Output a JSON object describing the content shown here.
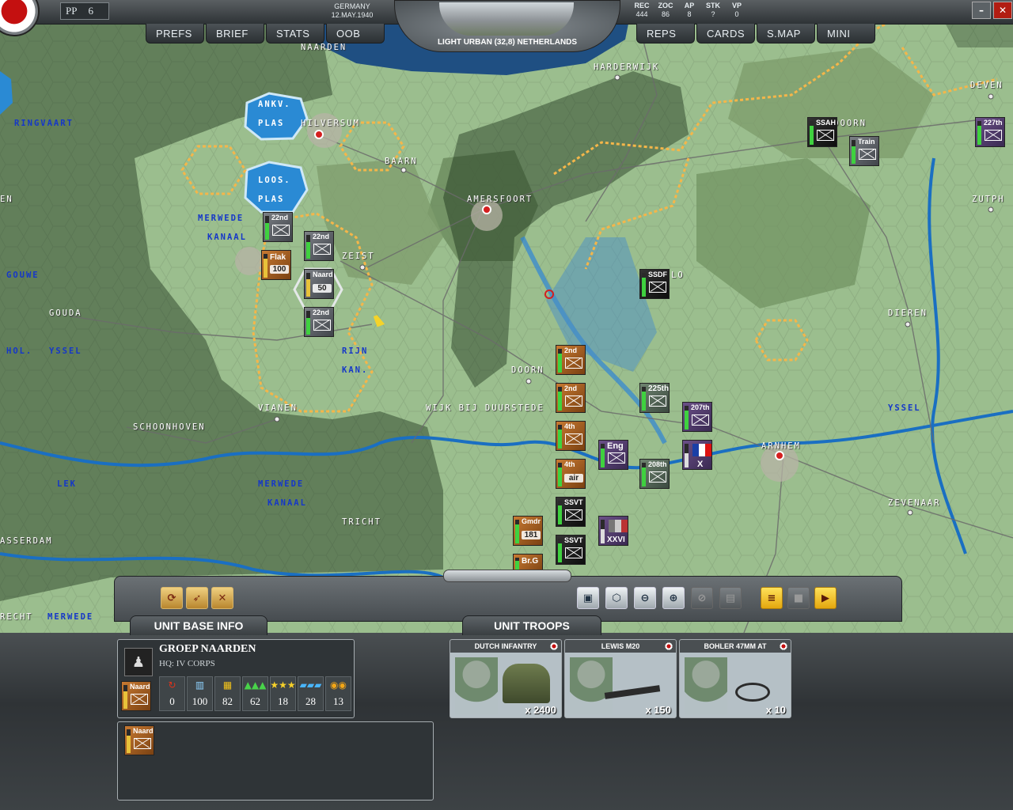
{
  "topbar": {
    "pp_label": "PP",
    "pp_value": "6",
    "nation": "GERMANY",
    "date": "12.MAY.1940",
    "terrain_info": "LIGHT URBAN (32,8) NETHERLANDS",
    "stats": [
      {
        "label": "REC",
        "value": "444"
      },
      {
        "label": "ZOC",
        "value": "86"
      },
      {
        "label": "AP",
        "value": "8"
      },
      {
        "label": "STK",
        "value": "?"
      },
      {
        "label": "VP",
        "value": "0"
      }
    ],
    "left_menu": [
      "PREFS",
      "BRIEF",
      "STATS",
      "OOB"
    ],
    "right_menu": [
      "REPS",
      "CARDS",
      "S.MAP",
      "MINI"
    ],
    "window_minimize": "–",
    "window_close": "✕"
  },
  "map": {
    "places": [
      {
        "id": "naarden",
        "name": "NAARDEN"
      },
      {
        "id": "harderwijk",
        "name": "HARDERWIJK"
      },
      {
        "id": "deventer",
        "name": "DEVEN"
      },
      {
        "id": "hilversum",
        "name": "HILVERSUM"
      },
      {
        "id": "apeldoorn",
        "name": "APELDOORN"
      },
      {
        "id": "baarn",
        "name": "BAARN"
      },
      {
        "id": "amersfoort",
        "name": "AMERSFOORT"
      },
      {
        "id": "zutphen",
        "name": "ZUTPH"
      },
      {
        "id": "zeist",
        "name": "ZEIST"
      },
      {
        "id": "barneveld",
        "name": "LO"
      },
      {
        "id": "gouda",
        "name": "GOUDA"
      },
      {
        "id": "dieren",
        "name": "DIEREN"
      },
      {
        "id": "doorn",
        "name": "DOORN"
      },
      {
        "id": "wijk",
        "name": "WIJK BIJ DUURSTEDE"
      },
      {
        "id": "vianen",
        "name": "VIANEN"
      },
      {
        "id": "schoonhoven",
        "name": "SCHOONHOVEN"
      },
      {
        "id": "arnhem",
        "name": "ARNHEM"
      },
      {
        "id": "zevenaar",
        "name": "ZEVENAAR"
      },
      {
        "id": "tricht",
        "name": "TRICHT"
      },
      {
        "id": "asserdam",
        "name": "ASSERDAM"
      },
      {
        "id": "recht",
        "name": "RECHT"
      },
      {
        "id": "left_edge",
        "name": "EN"
      }
    ],
    "waters": [
      {
        "id": "ringvaart",
        "name": "RINGVAART"
      },
      {
        "id": "ankv",
        "name": "ANKV."
      },
      {
        "id": "plas1",
        "name": "PLAS"
      },
      {
        "id": "loos",
        "name": "LOOS."
      },
      {
        "id": "plas2",
        "name": "PLAS"
      },
      {
        "id": "merwede1",
        "name": "MERWEDE"
      },
      {
        "id": "kanaal1",
        "name": "KANAAL"
      },
      {
        "id": "gouwe",
        "name": "GOUWE"
      },
      {
        "id": "hol",
        "name": "HOL."
      },
      {
        "id": "yssel1",
        "name": "YSSEL"
      },
      {
        "id": "rijn",
        "name": "RIJN"
      },
      {
        "id": "kan",
        "name": "KAN."
      },
      {
        "id": "yssel2",
        "name": "YSSEL"
      },
      {
        "id": "lek",
        "name": "LEK"
      },
      {
        "id": "merwede2",
        "name": "MERWEDE"
      },
      {
        "id": "kanaal2",
        "name": "KANAAL"
      },
      {
        "id": "merwede3",
        "name": "MERWEDE"
      }
    ],
    "units": [
      {
        "id": "u1",
        "label": "22nd",
        "color": "gray"
      },
      {
        "id": "u2",
        "label": "22nd",
        "color": "gray"
      },
      {
        "id": "u3",
        "label": "Flak",
        "num": "100",
        "color": "brown"
      },
      {
        "id": "u4",
        "label": "Naard",
        "num": "50",
        "color": "gray"
      },
      {
        "id": "u5",
        "label": "22nd",
        "color": "gray"
      },
      {
        "id": "u6",
        "label": "SSAH",
        "color": "black"
      },
      {
        "id": "u7",
        "label": "Train",
        "color": "gray"
      },
      {
        "id": "u8",
        "label": "227th",
        "color": "purple"
      },
      {
        "id": "u9",
        "label": "SSDF",
        "color": "black"
      },
      {
        "id": "u10",
        "label": "2nd",
        "color": "brown"
      },
      {
        "id": "u11",
        "label": "2nd",
        "color": "brown"
      },
      {
        "id": "u12",
        "label": "4th",
        "color": "brown"
      },
      {
        "id": "u13",
        "label": "4th",
        "num": "air",
        "color": "brown"
      },
      {
        "id": "u14",
        "label": "Eng",
        "color": "purple"
      },
      {
        "id": "u15",
        "label": "225th",
        "color": "dgreen"
      },
      {
        "id": "u16",
        "label": "207th",
        "color": "purple"
      },
      {
        "id": "u17",
        "label": "208th",
        "color": "dgreen"
      },
      {
        "id": "u18",
        "label": "X",
        "color": "purple"
      },
      {
        "id": "u19",
        "label": "SSVT",
        "color": "black"
      },
      {
        "id": "u20",
        "label": "Gmdr",
        "num": "181",
        "color": "brown"
      },
      {
        "id": "u21",
        "label": "XXVI",
        "color": "purple"
      },
      {
        "id": "u22",
        "label": "SSVT",
        "color": "black"
      },
      {
        "id": "u23",
        "label": "Br.G",
        "color": "brown"
      }
    ]
  },
  "toolbar": {
    "tabs": [
      "UNIT BASE INFO",
      "UNIT TROOPS"
    ],
    "left_buttons": [
      "cycle-units-icon",
      "artillery-icon",
      "engineer-icon"
    ],
    "right_buttons": [
      "unit-view-icon",
      "hex-info-icon",
      "zoom-out-icon",
      "zoom-in-icon",
      "zoom-disabled-icon",
      "trash-icon",
      "report-icon",
      "save-icon",
      "end-turn-icon"
    ]
  },
  "unit_info": {
    "name": "GROEP NAARDEN",
    "hq": "HQ: IV CORPS",
    "counter_label": "Naard",
    "values": [
      {
        "icon": "supply-icon",
        "value": "0"
      },
      {
        "icon": "strength-icon",
        "value": "100"
      },
      {
        "icon": "ammo-icon",
        "value": "82"
      },
      {
        "icon": "morale-icon",
        "value": "62"
      },
      {
        "icon": "experience-icon",
        "value": "18"
      },
      {
        "icon": "entrench-icon",
        "value": "28"
      },
      {
        "icon": "fuel-icon",
        "value": "13"
      }
    ],
    "list_counter_label": "Naard"
  },
  "troops": [
    {
      "name": "DUTCH INFANTRY",
      "count": "x 2400"
    },
    {
      "name": "LEWIS M20",
      "count": "x 150"
    },
    {
      "name": "BOHLER 47MM AT",
      "count": "x 10"
    }
  ]
}
